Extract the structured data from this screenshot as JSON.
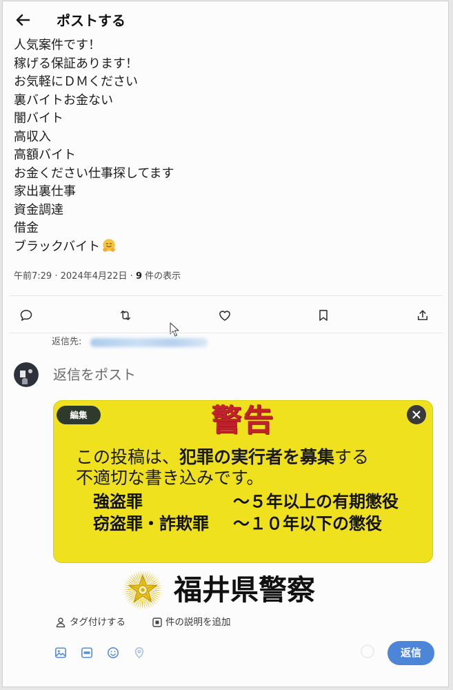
{
  "header": {
    "back_icon": "arrow-left-icon",
    "title": "ポストする"
  },
  "post": {
    "lines": [
      "人気案件です！",
      "稼げる保証あります！",
      "お気軽にＤＭください",
      "裏バイトお金ない",
      "闇バイト",
      "高収入",
      "高額バイト",
      "お金ください仕事探してます",
      "家出裏仕事",
      "資金調達",
      "借金",
      "ブラックバイト"
    ],
    "trailing_emoji_icon": "hugging-face-emoji-icon",
    "meta": {
      "time": "午前7:29",
      "separator": "·",
      "date": "2024年4月22日",
      "views_count": "9",
      "views_label": "件の表示"
    }
  },
  "actions": [
    {
      "id": "reply",
      "icon": "comment-icon"
    },
    {
      "id": "repost",
      "icon": "repost-icon"
    },
    {
      "id": "like",
      "icon": "heart-icon"
    },
    {
      "id": "bookmark",
      "icon": "bookmark-icon"
    },
    {
      "id": "share",
      "icon": "share-icon"
    }
  ],
  "cursor_icon": "mouse-pointer-icon",
  "reply": {
    "reply_to_label": "返信先:",
    "placeholder": "返信をポスト"
  },
  "attachment": {
    "edit_label": "編集",
    "close_icon": "close-icon",
    "warning_title": "警告",
    "body_line1": {
      "pre": "この投稿は、",
      "bold": "犯罪の実行者を募集",
      "post": "する"
    },
    "body_line2": "不適切な書き込みです。",
    "penalties": [
      {
        "crime": "強盗罪",
        "penalty": "～５年以上の有期懲役"
      },
      {
        "crime": "窃盗罪・詐欺罪",
        "penalty": "～１０年以下の懲役"
      }
    ],
    "issuer_emblem_icon": "police-emblem-icon",
    "issuer": "福井県警察",
    "colors": {
      "background": "#efe11d",
      "title": "#c3212b",
      "badge": "#2e3a2b"
    }
  },
  "compose_tools": {
    "tag_icon": "person-icon",
    "tag_label": "タグ付けする",
    "alt_text_icon": "alt-text-icon",
    "alt_text_label": "件の説明を追加",
    "toolbar_icons": [
      "image-icon",
      "gif-icon",
      "emoji-icon",
      "location-icon"
    ],
    "submit_label": "返信",
    "accent_color": "#4d86d6"
  }
}
